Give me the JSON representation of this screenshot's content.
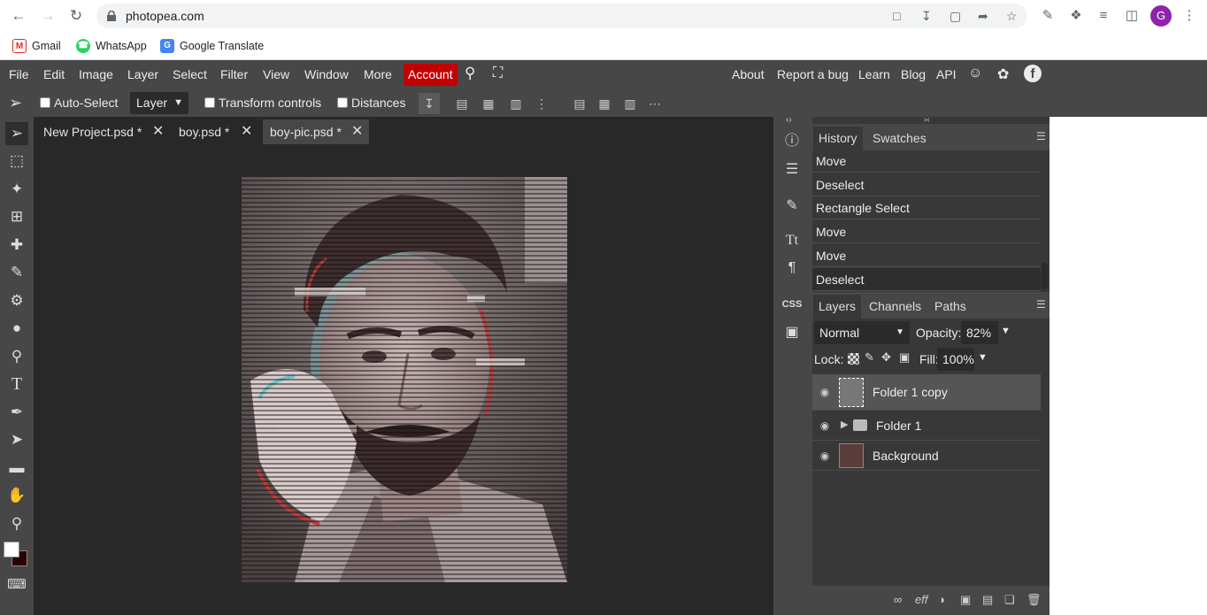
{
  "browser": {
    "url": "photopea.com",
    "bookmarks": [
      {
        "label": "Gmail",
        "icon": "gmail-icon",
        "color": "#d93025"
      },
      {
        "label": "WhatsApp",
        "icon": "whatsapp-icon",
        "color": "#25d366"
      },
      {
        "label": "Google Translate",
        "icon": "google-translate-icon",
        "color": "#4285f4"
      }
    ],
    "avatar_letter": "G"
  },
  "menu": {
    "items": [
      "File",
      "Edit",
      "Image",
      "Layer",
      "Select",
      "Filter",
      "View",
      "Window",
      "More"
    ],
    "account": "Account",
    "right": [
      "About",
      "Report a bug",
      "Learn",
      "Blog",
      "API"
    ]
  },
  "options": {
    "auto_select": "Auto-Select",
    "layer_select": "Layer",
    "transform_controls": "Transform controls",
    "distances": "Distances"
  },
  "tabs": [
    {
      "label": "New Project.psd *",
      "active": false
    },
    {
      "label": "boy.psd *",
      "active": false
    },
    {
      "label": "boy-pic.psd *",
      "active": true
    }
  ],
  "history_panel": {
    "tabs": [
      "History",
      "Swatches"
    ],
    "items": [
      "Move",
      "Deselect",
      "Rectangle Select",
      "Move",
      "Move",
      "Deselect"
    ]
  },
  "layers_panel": {
    "tabs": [
      "Layers",
      "Channels",
      "Paths"
    ],
    "blend_mode": "Normal",
    "opacity_label": "Opacity:",
    "opacity": "82%",
    "lock_label": "Lock:",
    "fill_label": "Fill:",
    "fill": "100%",
    "layers": [
      {
        "name": "Folder 1 copy",
        "selected": true
      },
      {
        "name": "Folder 1",
        "selected": false
      },
      {
        "name": "Background",
        "selected": false
      }
    ]
  },
  "colors": {
    "accent": "#c20000",
    "panel_bg": "#383838",
    "chrome_bg": "#474747",
    "workspace_bg": "#282828"
  }
}
